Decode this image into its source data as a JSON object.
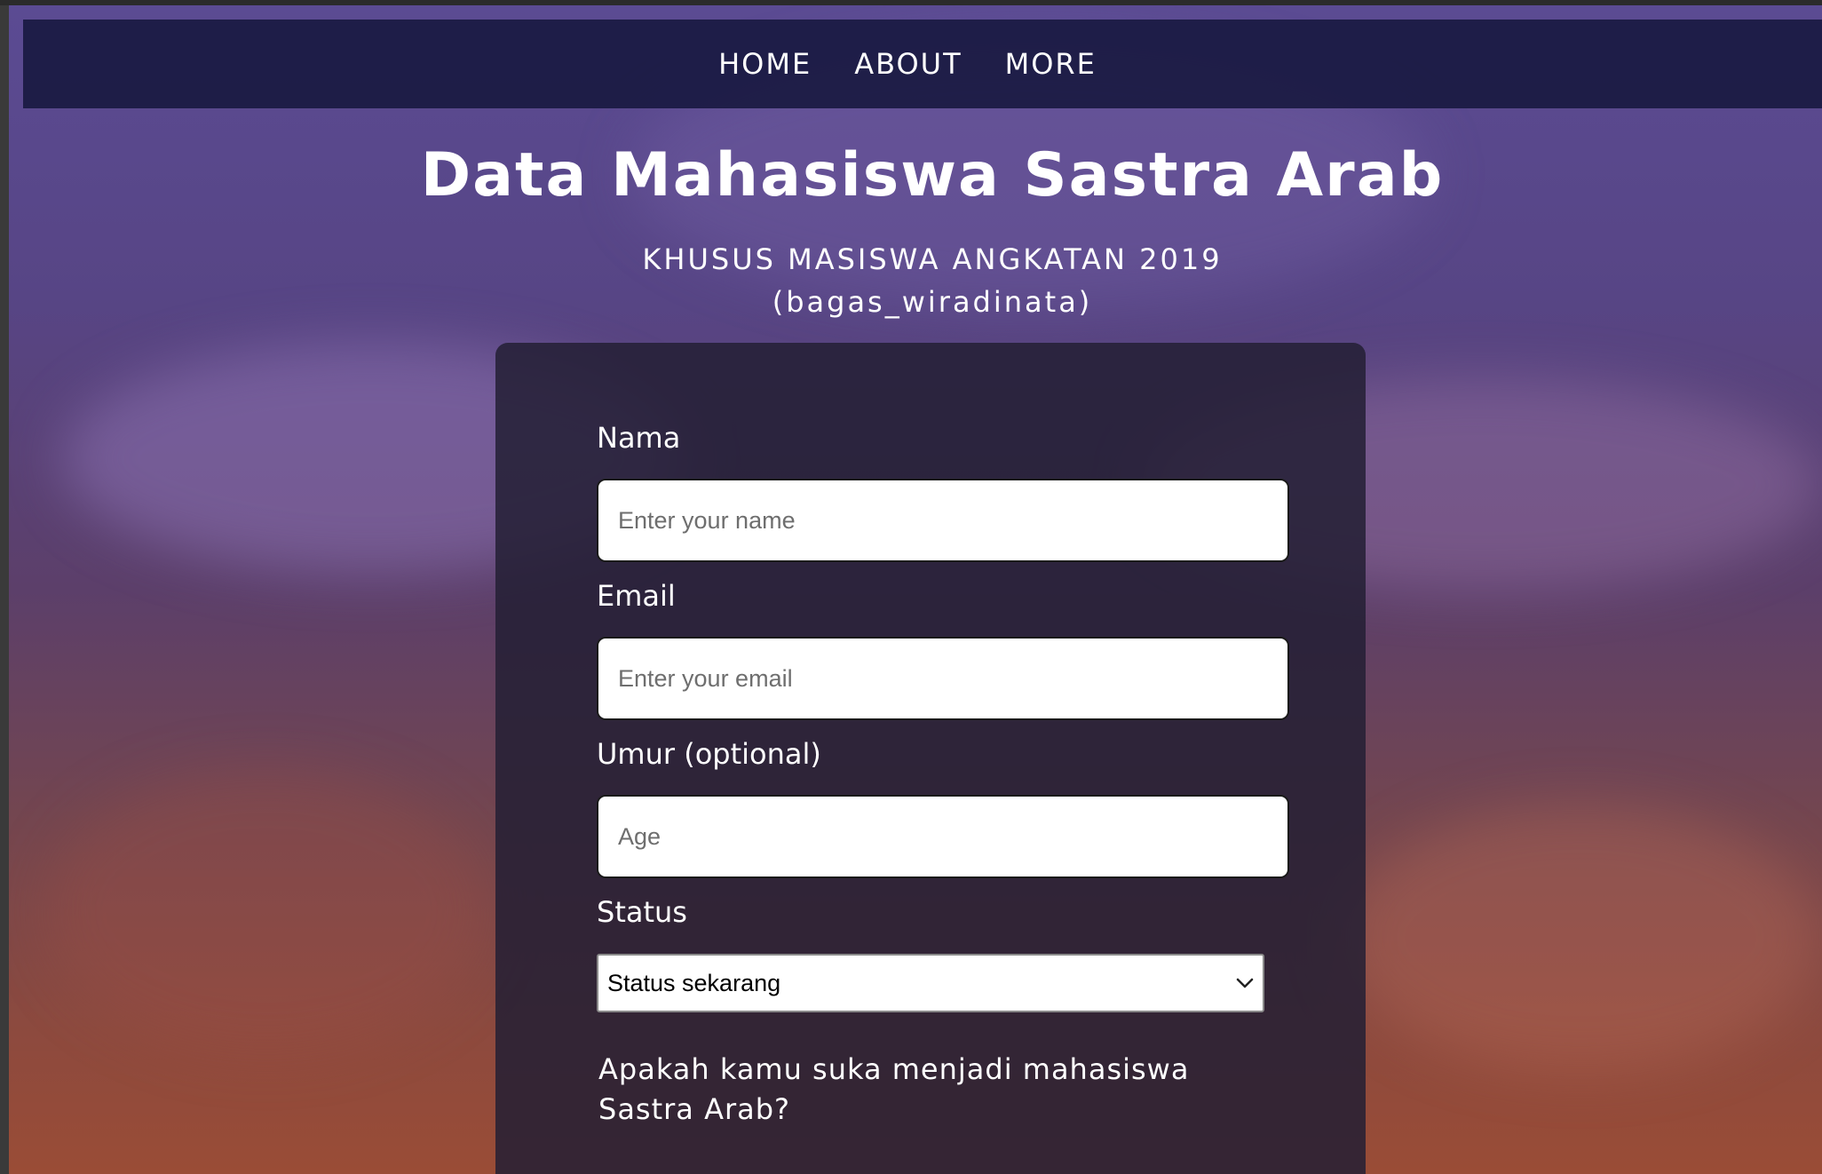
{
  "nav": {
    "items": [
      "HOME",
      "ABOUT",
      "MORE"
    ]
  },
  "header": {
    "title": "Data Mahasiswa Sastra Arab",
    "subtitle_line1": "KHUSUS MASISWA ANGKATAN 2019",
    "subtitle_line2": "(bagas_wiradinata)"
  },
  "form": {
    "name_label": "Nama",
    "name_placeholder": "Enter your name",
    "email_label": "Email",
    "email_placeholder": "Enter your email",
    "age_label": "Umur (optional)",
    "age_placeholder": "Age",
    "status_label": "Status",
    "status_selected": "Status sekarang",
    "question": "Apakah kamu suka menjadi mahasiswa Sastra Arab?"
  },
  "icons": {
    "select_arrow": "chevron-down-icon"
  },
  "colors": {
    "navbar": "#16173e",
    "card": "#231e34",
    "text": "#ffffff"
  }
}
